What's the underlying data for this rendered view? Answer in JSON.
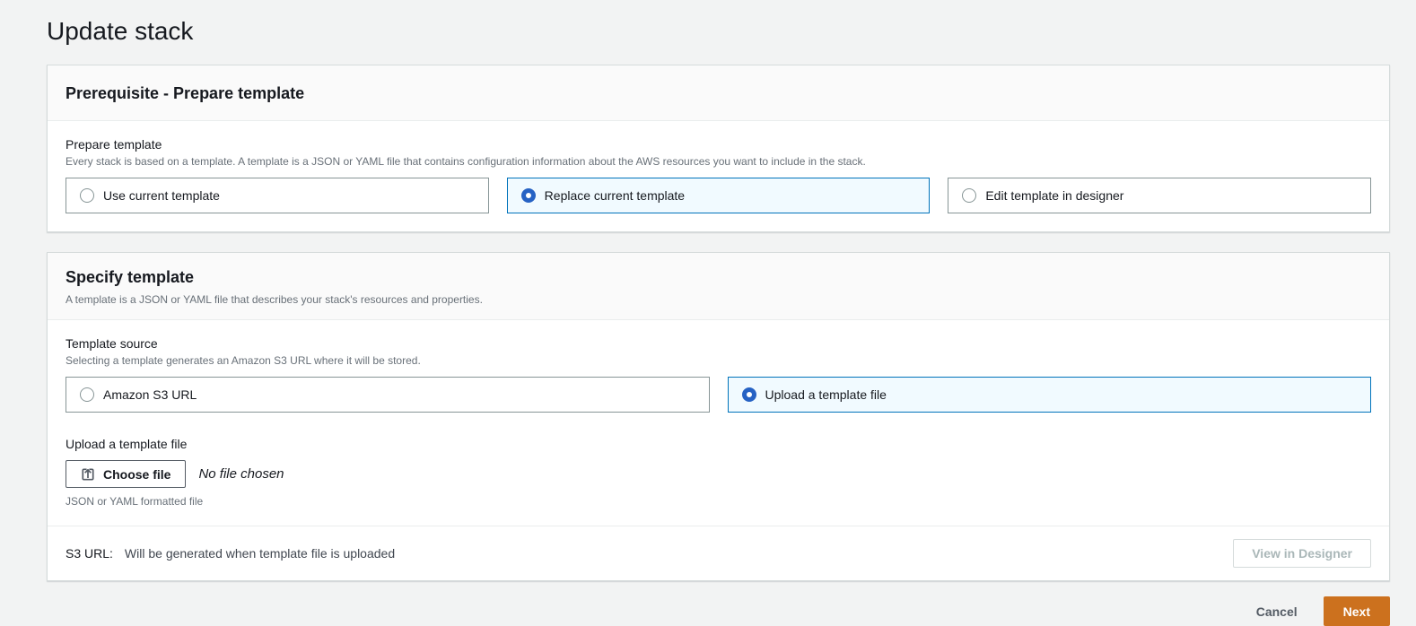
{
  "page": {
    "title": "Update stack"
  },
  "colors": {
    "page_background": "#f2f3f3",
    "selected_tile_border": "#0073bb",
    "selected_tile_background": "#f1faff",
    "radio_accent": "#2662c4",
    "primary_button": "#cc711e",
    "secondary_text": "#687078"
  },
  "prerequisite_card": {
    "title": "Prerequisite - Prepare template",
    "field_label": "Prepare template",
    "field_description": "Every stack is based on a template. A template is a JSON or YAML file that contains configuration information about the AWS resources you want to include in the stack.",
    "options": [
      {
        "label": "Use current template",
        "selected": false
      },
      {
        "label": "Replace current template",
        "selected": true
      },
      {
        "label": "Edit template in designer",
        "selected": false
      }
    ]
  },
  "specify_card": {
    "title": "Specify template",
    "description": "A template is a JSON or YAML file that describes your stack's resources and properties.",
    "template_source": {
      "label": "Template source",
      "description": "Selecting a template generates an Amazon S3 URL where it will be stored.",
      "options": [
        {
          "label": "Amazon S3 URL",
          "selected": false
        },
        {
          "label": "Upload a template file",
          "selected": true
        }
      ]
    },
    "upload": {
      "label": "Upload a template file",
      "choose_file_label": "Choose file",
      "no_file_text": "No file chosen",
      "constraint": "JSON or YAML formatted file"
    },
    "footer": {
      "s3_label": "S3 URL:",
      "s3_value": "Will be generated when template file is uploaded",
      "view_designer_label": "View in Designer"
    }
  },
  "actions": {
    "cancel_label": "Cancel",
    "next_label": "Next"
  }
}
